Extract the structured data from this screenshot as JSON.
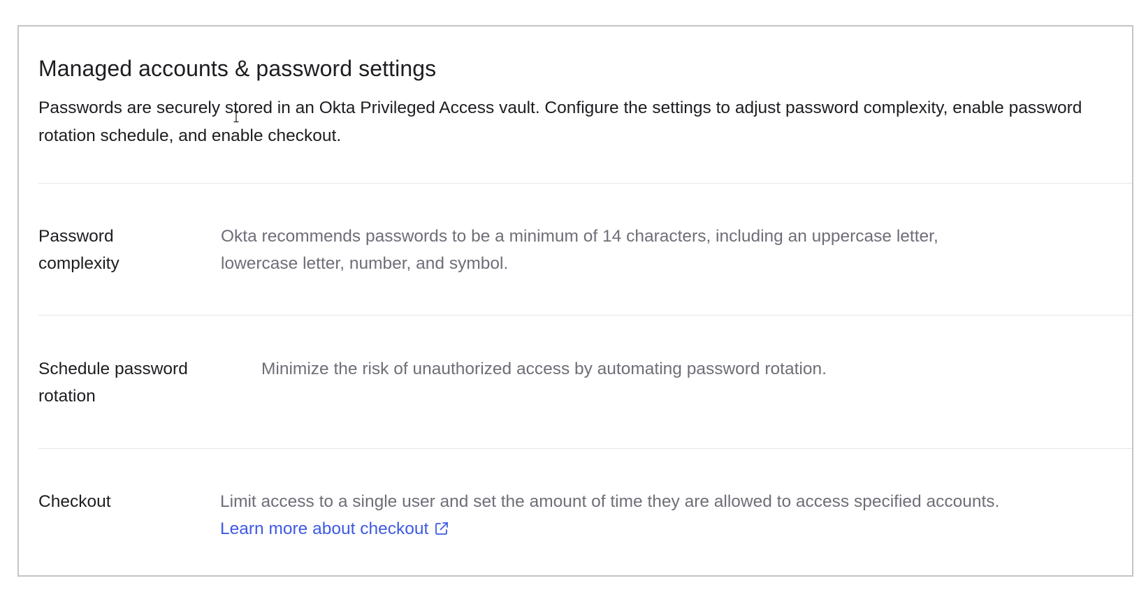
{
  "header": {
    "title": "Managed accounts & password settings",
    "description": "Passwords are securely stored in an Okta Privileged Access vault. Configure the settings to adjust password complexity, enable password rotation schedule, and enable checkout."
  },
  "settings": [
    {
      "label": "Password complexity",
      "description": "Okta recommends passwords to be a minimum of 14 characters, including an uppercase letter, lowercase letter, number, and symbol."
    },
    {
      "label": "Schedule password rotation",
      "description": "Minimize the risk of unauthorized access by automating password rotation."
    },
    {
      "label": "Checkout",
      "description": "Limit access to a single user and set the amount of time they are allowed to access specified accounts.",
      "link_label": "Learn more about checkout",
      "link_icon": "external-link-icon"
    }
  ],
  "colors": {
    "text_primary": "#1d1d21",
    "text_secondary": "#6e6e78",
    "link": "#3f59e4",
    "border": "#c5c5c7",
    "divider": "#e6e6e8"
  }
}
